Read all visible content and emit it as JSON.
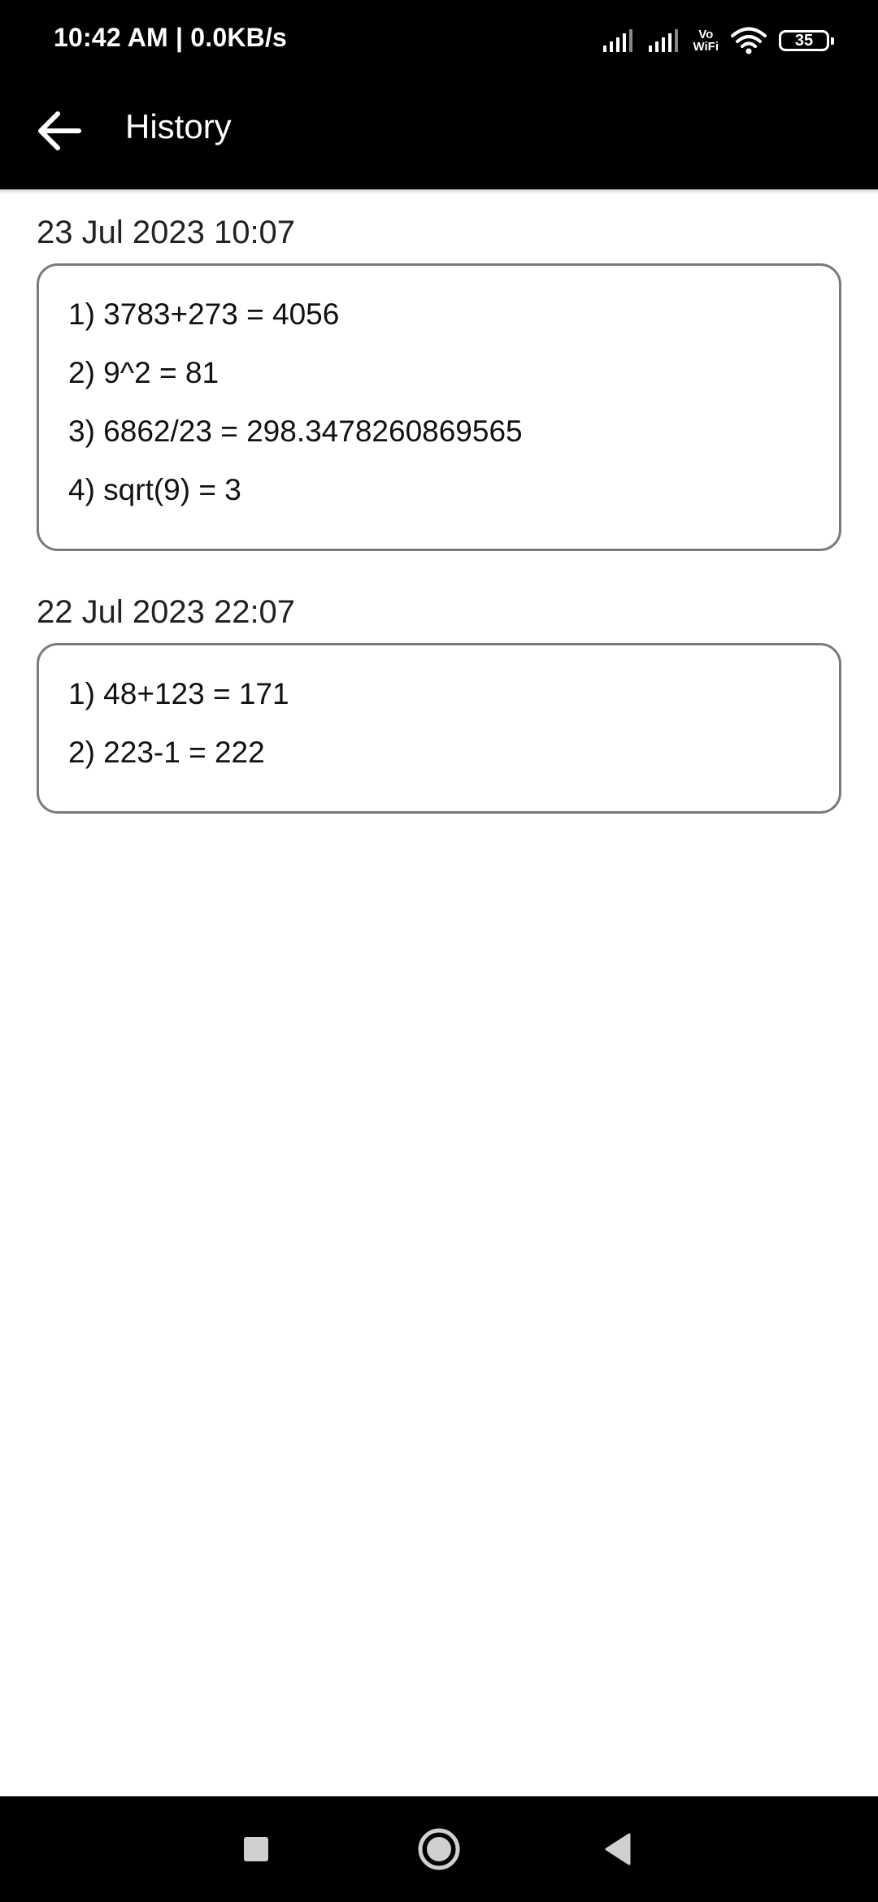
{
  "status_bar": {
    "time": "10:42 AM | 0.0KB/s",
    "vowifi_top": "Vo",
    "vowifi_bottom": "WiFi",
    "battery": "35"
  },
  "toolbar": {
    "title": "History"
  },
  "sessions": [
    {
      "date": "23 Jul 2023 10:07",
      "lines": [
        "1) 3783+273 = 4056",
        "2) 9^2 = 81",
        "3) 6862/23 = 298.3478260869565",
        "4) sqrt(9) = 3"
      ]
    },
    {
      "date": "22 Jul 2023 22:07",
      "lines": [
        "1) 48+123 = 171",
        "2) 223-1 = 222"
      ]
    }
  ],
  "colors": {
    "header_bg": "#000000",
    "page_bg": "#ffffff",
    "card_border": "#7a7a7a"
  }
}
